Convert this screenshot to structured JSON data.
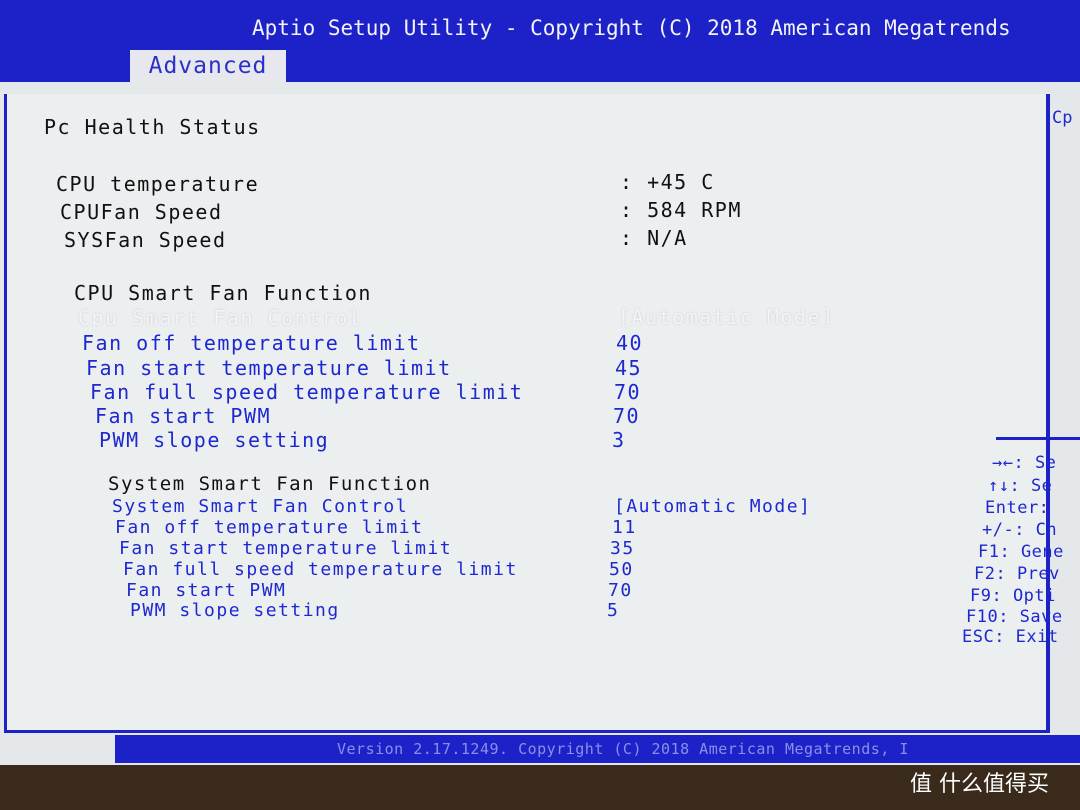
{
  "title": "Aptio Setup Utility - Copyright (C) 2018 American Megatrends",
  "tab": "Advanced",
  "page_title": "Pc Health Status",
  "status": [
    {
      "label": "CPU temperature",
      "value": ": +45 C"
    },
    {
      "label": "CPUFan Speed",
      "value": ": 584 RPM"
    },
    {
      "label": "SYSFan Speed",
      "value": ": N/A"
    }
  ],
  "cpu_fan": {
    "heading": "CPU Smart Fan Function",
    "items": [
      {
        "label": "Cpu Smart Fan Control",
        "value": "[Automatic Mode]"
      },
      {
        "label": "Fan off temperature limit",
        "value": "40"
      },
      {
        "label": "Fan start temperature limit",
        "value": "45"
      },
      {
        "label": "Fan full speed temperature limit",
        "value": "70"
      },
      {
        "label": "Fan start PWM",
        "value": "70"
      },
      {
        "label": "PWM slope setting",
        "value": "3"
      }
    ]
  },
  "sys_fan": {
    "heading": "System Smart Fan Function",
    "items": [
      {
        "label": "System Smart Fan Control",
        "value": "[Automatic Mode]"
      },
      {
        "label": "Fan off temperature limit",
        "value": "11"
      },
      {
        "label": "Fan start temperature limit",
        "value": "35"
      },
      {
        "label": "Fan full speed temperature limit",
        "value": "50"
      },
      {
        "label": "Fan start PWM",
        "value": "70"
      },
      {
        "label": "PWM slope setting",
        "value": "5"
      }
    ]
  },
  "help_title": "Cp",
  "help_keys": [
    "→←: Se",
    "↑↓: Se",
    "Enter:",
    "+/-: Ch",
    "F1: Gene",
    "F2: Prev",
    "F9: Opti",
    "F10: Save",
    "ESC: Exit"
  ],
  "footer": "Version 2.17.1249. Copyright (C) 2018 American Megatrends, I",
  "watermark": "值 什么值得买"
}
